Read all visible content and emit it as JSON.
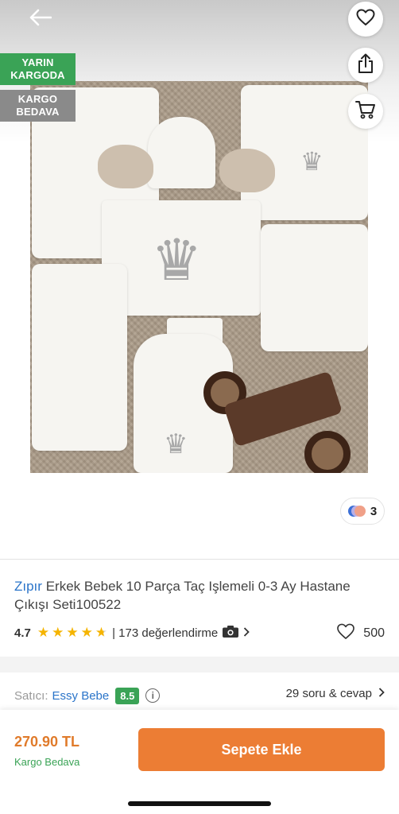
{
  "header": {
    "back_icon": "arrow-left-icon",
    "favorite_icon": "heart-icon",
    "share_icon": "share-icon",
    "cart_icon": "cart-icon"
  },
  "badges": {
    "delivery_line1": "YARIN",
    "delivery_line2": "KARGODA",
    "free_line1": "KARGO",
    "free_line2": "BEDAVA"
  },
  "gallery": {
    "color_count": "3"
  },
  "product": {
    "brand": "Zıpır",
    "name": "Erkek Bebek 10 Parça Taç Işlemeli 0-3 Ay Hastane Çıkışı Seti100522",
    "rating": "4.7",
    "stars_filled": 4.7,
    "review_text": "| 173 değerlendirme",
    "review_icon": "camera-icon",
    "favorite_count": "500"
  },
  "seller": {
    "label": "Satıcı:",
    "name": "Essy Bebe",
    "score": "8.5",
    "info_icon": "info-icon",
    "qa_text": "29 soru & cevap"
  },
  "bottom_bar": {
    "price": "270.90 TL",
    "shipping": "Kargo Bedava",
    "add_to_cart": "Sepete Ekle"
  },
  "colors": {
    "accent_orange": "#ec7d34",
    "price_orange": "#e07b2b",
    "green": "#3aa356",
    "link_blue": "#2a74c9",
    "star_yellow": "#f5b400"
  }
}
